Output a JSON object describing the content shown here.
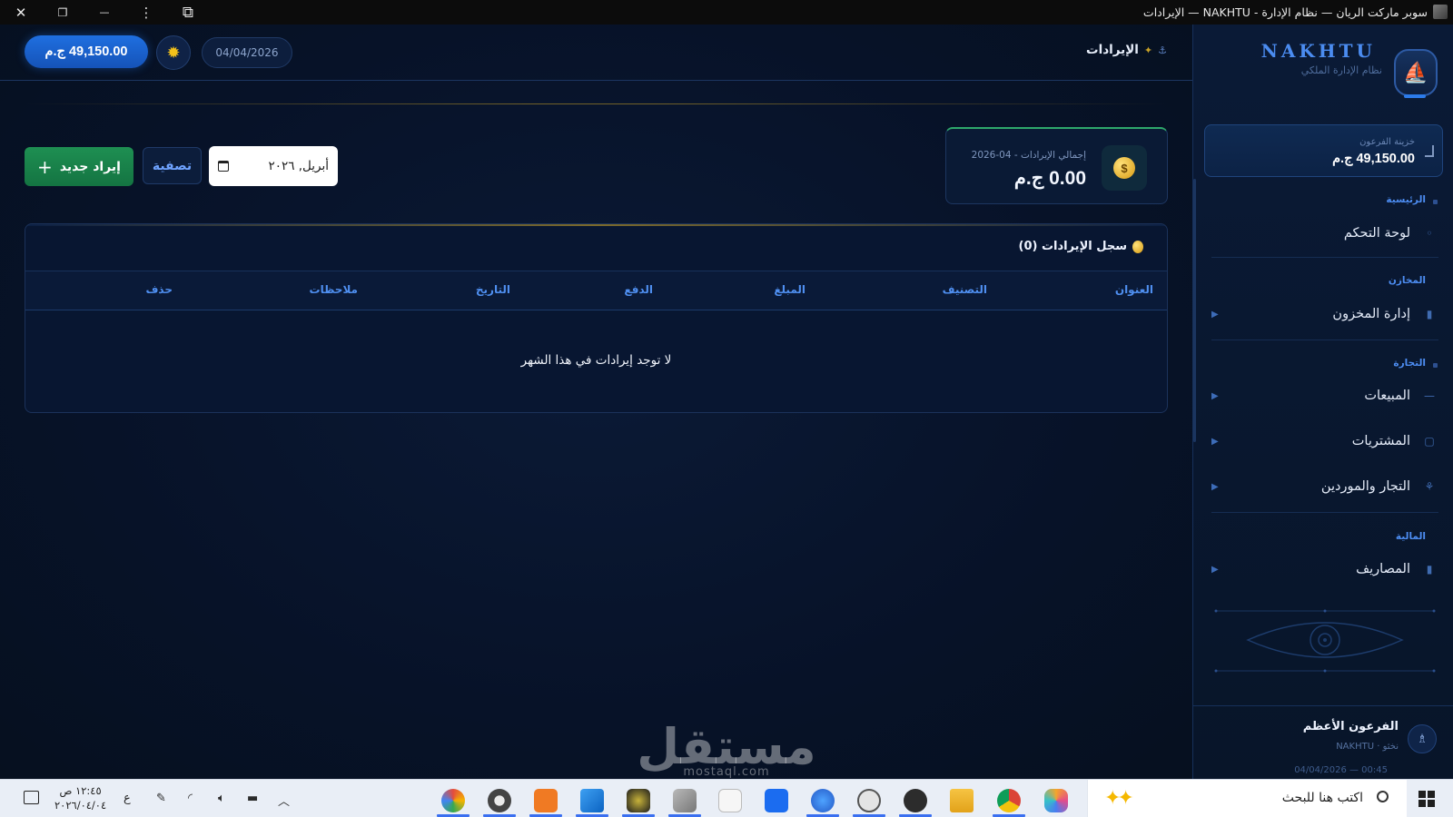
{
  "window": {
    "title": "سوبر ماركت الريان — نظام الإدارة - NAKHTU — الإيرادات",
    "close_glyph": "✕",
    "restore_glyph": "❐",
    "minimize_glyph": "—",
    "more_glyph": "⋮",
    "ext_glyph": "⧉"
  },
  "header": {
    "page_title": "الإيرادات",
    "date": "04/04/2026",
    "balance": "49,150.00 ج.م",
    "theme_glyph": "✹"
  },
  "summary": {
    "label": "إجمالي الإيرادات - 04-2026",
    "value": "0.00 ج.م",
    "icon_glyph": "$"
  },
  "controls": {
    "month_value": "أبريل, ٢٠٢٦",
    "filter_label": "تصفية",
    "add_label": "إيراد جديد",
    "add_glyph": "+"
  },
  "log": {
    "title": "سجل الإيرادات (0)",
    "columns": [
      "العنوان",
      "التصنيف",
      "المبلغ",
      "الدفع",
      "التاريخ",
      "ملاحظات",
      "حذف"
    ],
    "empty_message": "لا توجد إيرادات في هذا الشهر"
  },
  "watermark": {
    "main": "مستقل",
    "sub": "mostaql.com"
  },
  "sidebar": {
    "brand": "NAKHTU",
    "brand_sub": "نظام الإدارة الملكي",
    "treasury_label": "خزينة الفرعون",
    "treasury_value": "49,150.00 ج.م",
    "sections": [
      {
        "title": "الرئيسية",
        "items": [
          {
            "label": "لوحة التحكم",
            "icon": "◦"
          }
        ]
      },
      {
        "title": "المخازن",
        "items": [
          {
            "label": "إدارة المخزون",
            "icon": "▮"
          }
        ]
      },
      {
        "title": "التجارة",
        "items": [
          {
            "label": "المبيعات",
            "icon": "—"
          },
          {
            "label": "المشتريات",
            "icon": "▢"
          },
          {
            "label": "التجار والموردين",
            "icon": "⚘"
          }
        ]
      },
      {
        "title": "المالية",
        "items": [
          {
            "label": "المصاريف",
            "icon": "▮"
          }
        ]
      }
    ],
    "arrow_glyph": "▶",
    "user_name": "الفرعون الأعظم",
    "user_role": "نخثو · NAKHTU",
    "user_time": "04/04/2026 — 00:45",
    "user_glyph": "♗"
  },
  "taskbar": {
    "search_placeholder": "اكتب هنا للبحث",
    "clock_time": "١٢:٤٥ ص",
    "clock_date": "٢٠٢٦/٠٤/٠٤",
    "lang": "ع",
    "sparkle_glyph": "✦✦"
  },
  "colors": {
    "accent_blue": "#1f6fe0",
    "accent_green": "#1e8f52",
    "gold": "#c9a227",
    "background": "#07132a"
  }
}
